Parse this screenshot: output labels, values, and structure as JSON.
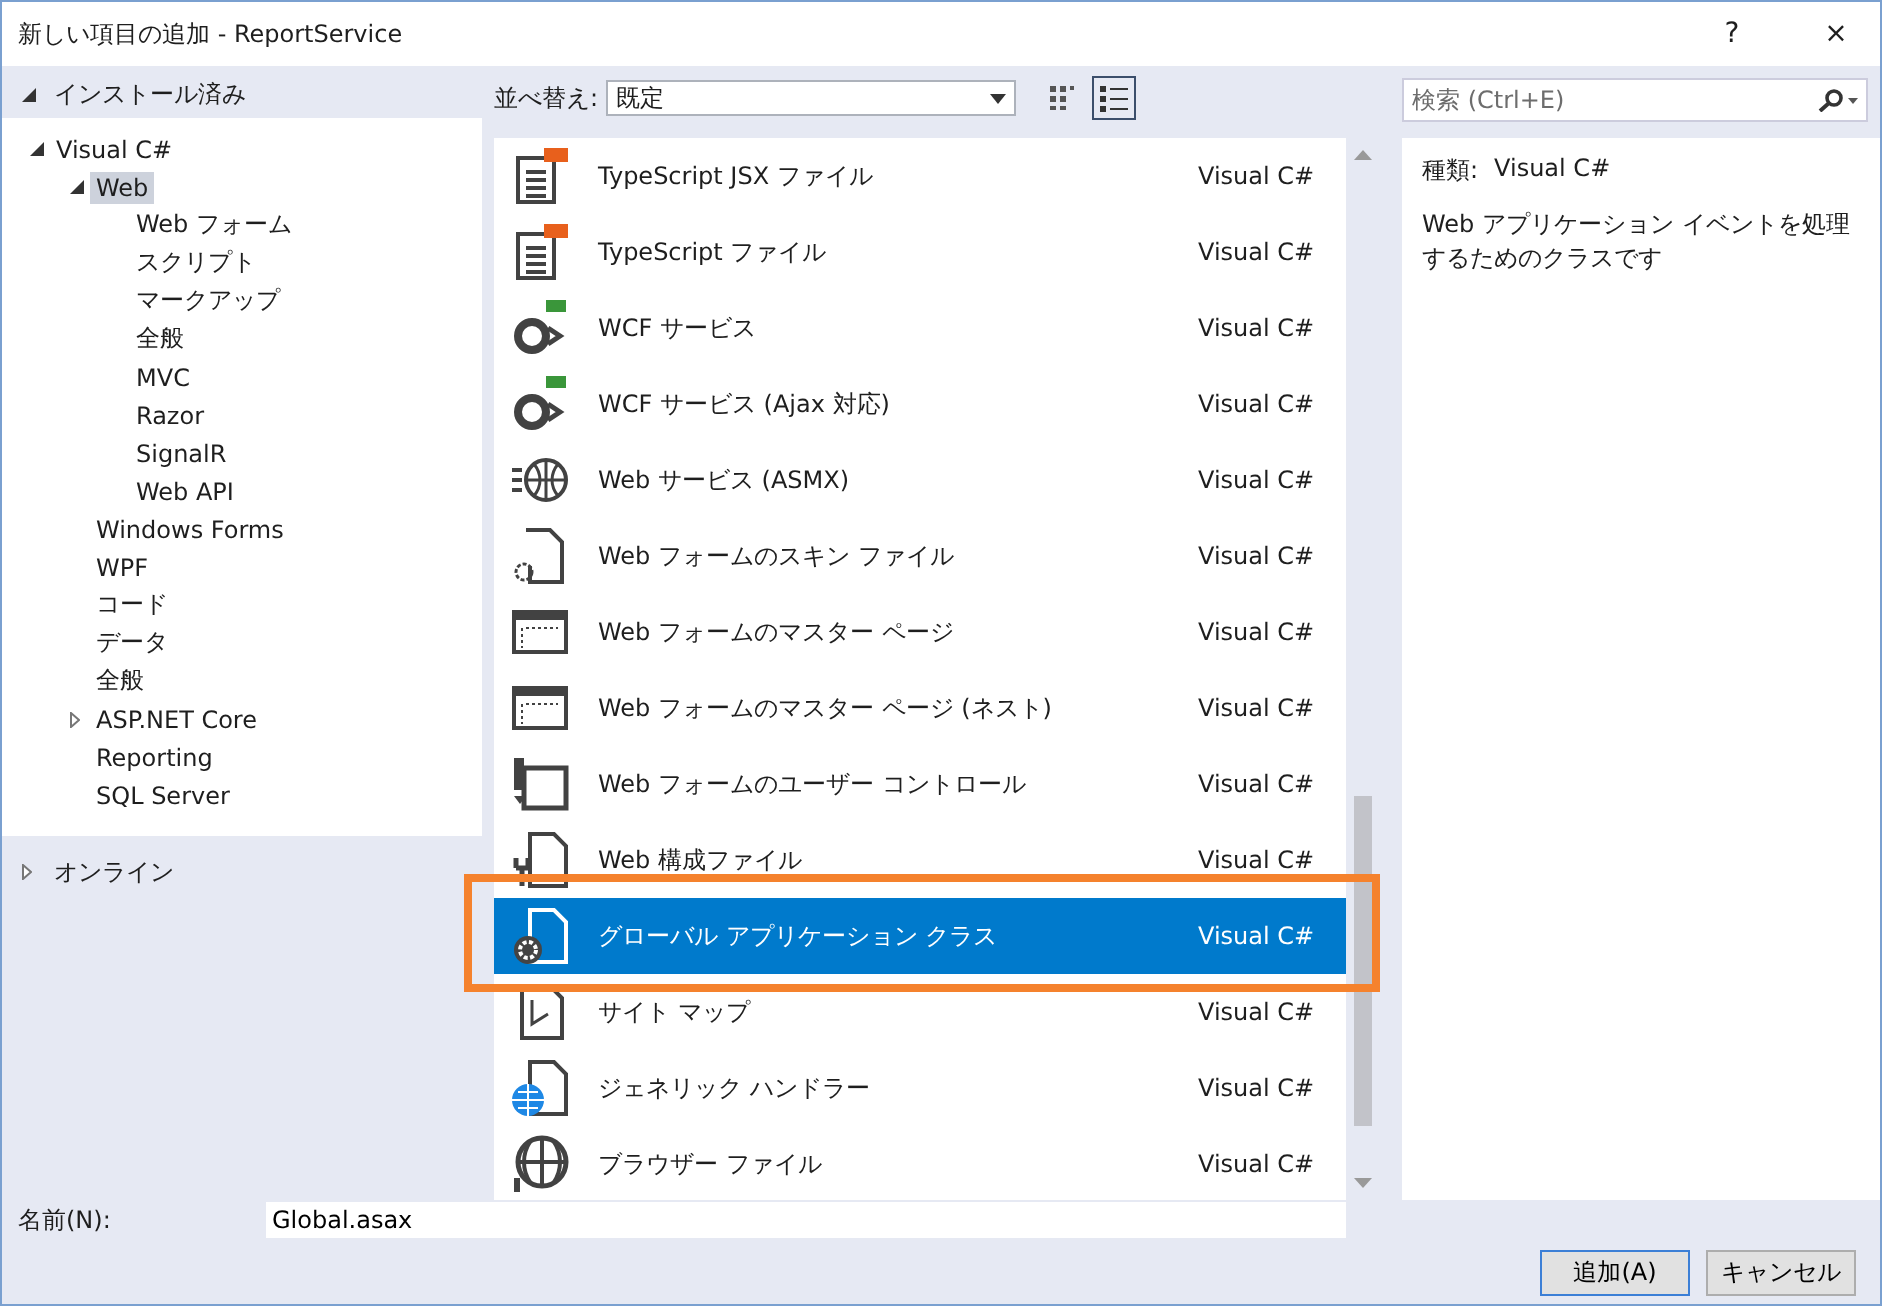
{
  "window": {
    "title": "新しい項目の追加 - ReportService",
    "help": "?",
    "close": "×"
  },
  "sidebar": {
    "installed": {
      "label": "インストール済み",
      "expanded": true
    },
    "tree": [
      {
        "label": "Visual C#",
        "expanded": true,
        "selected": false,
        "children": [
          {
            "label": "Web",
            "expanded": true,
            "selected": true,
            "children": [
              {
                "label": "Web フォーム",
                "selected": false
              },
              {
                "label": "スクリプト",
                "selected": false
              },
              {
                "label": "マークアップ",
                "selected": false
              },
              {
                "label": "全般",
                "selected": false
              },
              {
                "label": "MVC",
                "selected": false
              },
              {
                "label": "Razor",
                "selected": false
              },
              {
                "label": "SignalR",
                "selected": false
              },
              {
                "label": "Web API",
                "selected": false
              }
            ]
          },
          {
            "label": "Windows Forms",
            "selected": false
          },
          {
            "label": "WPF",
            "selected": false
          },
          {
            "label": "コード",
            "selected": false
          },
          {
            "label": "データ",
            "selected": false
          },
          {
            "label": "全般",
            "selected": false
          },
          {
            "label": "ASP.NET Core",
            "expanded": false,
            "selected": false
          },
          {
            "label": "Reporting",
            "selected": false
          },
          {
            "label": "SQL Server",
            "selected": false
          }
        ]
      }
    ],
    "online": {
      "label": "オンライン",
      "expanded": false
    }
  },
  "toolbar": {
    "sort_label": "並べ替え:",
    "sort_value": "既定",
    "views": [
      {
        "kind": "grid",
        "selected": false
      },
      {
        "kind": "list",
        "selected": true
      }
    ]
  },
  "items": [
    {
      "name": "TypeScript JSX ファイル",
      "type": "Visual C#",
      "kind": "ts",
      "selected": false
    },
    {
      "name": "TypeScript ファイル",
      "type": "Visual C#",
      "kind": "ts",
      "selected": false
    },
    {
      "name": "WCF サービス",
      "type": "Visual C#",
      "kind": "wcf",
      "selected": false
    },
    {
      "name": "WCF サービス (Ajax 対応)",
      "type": "Visual C#",
      "kind": "wcf",
      "selected": false
    },
    {
      "name": "Web サービス (ASMX)",
      "type": "Visual C#",
      "kind": "service",
      "selected": false
    },
    {
      "name": "Web フォームのスキン ファイル",
      "type": "Visual C#",
      "kind": "skin",
      "selected": false
    },
    {
      "name": "Web フォームのマスター ページ",
      "type": "Visual C#",
      "kind": "master",
      "selected": false
    },
    {
      "name": "Web フォームのマスター ページ (ネスト)",
      "type": "Visual C#",
      "kind": "master",
      "selected": false
    },
    {
      "name": "Web フォームのユーザー コントロール",
      "type": "Visual C#",
      "kind": "control",
      "selected": false
    },
    {
      "name": "Web 構成ファイル",
      "type": "Visual C#",
      "kind": "config",
      "selected": false
    },
    {
      "name": "グローバル アプリケーション クラス",
      "type": "Visual C#",
      "kind": "global",
      "selected": true,
      "highlighted": true
    },
    {
      "name": "サイト マップ",
      "type": "Visual C#",
      "kind": "sitemap",
      "selected": false
    },
    {
      "name": "ジェネリック ハンドラー",
      "type": "Visual C#",
      "kind": "handler",
      "selected": false
    },
    {
      "name": "ブラウザー ファイル",
      "type": "Visual C#",
      "kind": "browser",
      "selected": false
    }
  ],
  "search": {
    "placeholder": "検索 (Ctrl+E)"
  },
  "details": {
    "type_label": "種類:",
    "type_value": "Visual C#",
    "description": "Web アプリケーション イベントを処理するためのクラスです"
  },
  "name_field": {
    "label": "名前(N):",
    "value": "Global.asax"
  },
  "buttons": [
    {
      "label": "追加(A)",
      "kind": "primary"
    },
    {
      "label": "キャンセル",
      "kind": "secondary"
    }
  ]
}
